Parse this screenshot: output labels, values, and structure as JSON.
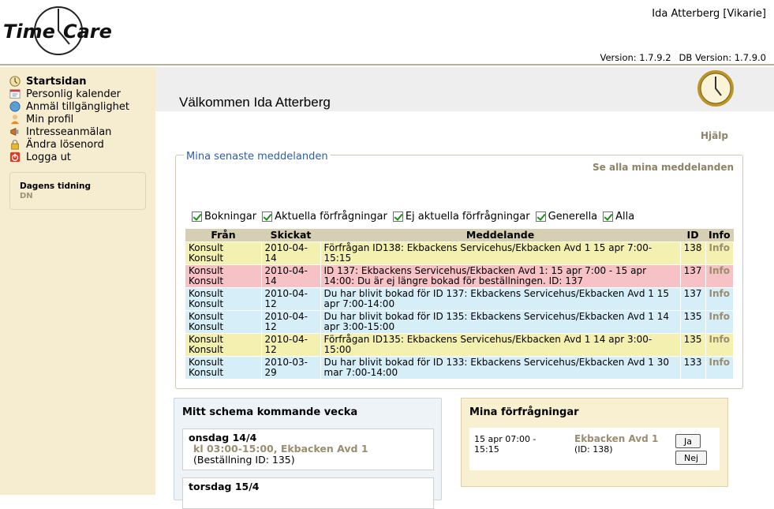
{
  "header": {
    "user": "Ida Atterberg [Vikarie]",
    "version": "Version: 1.7.9.2",
    "db_version": "DB Version: 1.7.9.0",
    "logo_text": "TimeCare"
  },
  "sidebar": {
    "items": [
      {
        "label": "Startsidan",
        "icon": "clock-icon",
        "active": true
      },
      {
        "label": "Personlig kalender",
        "icon": "calendar-icon"
      },
      {
        "label": "Anmäl tillgänglighet",
        "icon": "globe-icon"
      },
      {
        "label": "Min profil",
        "icon": "user-icon"
      },
      {
        "label": "Intresseanmälan",
        "icon": "megaphone-icon"
      },
      {
        "label": "Ändra lösenord",
        "icon": "lock-icon"
      },
      {
        "label": "Logga ut",
        "icon": "logout-icon"
      }
    ],
    "news": {
      "title": "Dagens tidning",
      "value": "DN"
    }
  },
  "main": {
    "welcome": "Välkommen Ida Atterberg",
    "help": "Hjälp"
  },
  "messages": {
    "title": "Mina senaste meddelanden",
    "see_all": "Se alla mina meddelanden",
    "filters": [
      "Bokningar",
      "Aktuella förfrågningar",
      "Ej aktuella förfrågningar",
      "Generella",
      "Alla"
    ],
    "columns": [
      "Från",
      "Skickat",
      "Meddelande",
      "ID",
      "Info"
    ],
    "rows": [
      {
        "from": "Konsult Konsult",
        "sent": "2010-04-14",
        "message": "Förfrågan ID138: Ekbackens Servicehus/Ekbacken Avd 1 15 apr 7:00-15:15",
        "id": "138",
        "info": "Info"
      },
      {
        "from": "Konsult Konsult",
        "sent": "2010-04-14",
        "message": "ID 137: Ekbackens Servicehus/Ekbacken Avd 1: 15 apr 7:00 - 15 apr 14:00: Du är ej längre bokad för beställningen. ID: 137",
        "id": "137",
        "info": "Info"
      },
      {
        "from": "Konsult Konsult",
        "sent": "2010-04-12",
        "message": "Du har blivit bokad för ID 137: Ekbackens Servicehus/Ekbacken Avd 1 15 apr 7:00-14:00",
        "id": "137",
        "info": "Info"
      },
      {
        "from": "Konsult Konsult",
        "sent": "2010-04-12",
        "message": "Du har blivit bokad för ID 135: Ekbackens Servicehus/Ekbacken Avd 1 14 apr 3:00-15:00",
        "id": "135",
        "info": "Info"
      },
      {
        "from": "Konsult Konsult",
        "sent": "2010-04-12",
        "message": "Förfrågan ID135: Ekbackens Servicehus/Ekbacken Avd 1 14 apr 3:00-15:00",
        "id": "135",
        "info": "Info"
      },
      {
        "from": "Konsult Konsult",
        "sent": "2010-03-29",
        "message": "Du har blivit bokad för ID 133: Ekbackens Servicehus/Ekbacken Avd 1 30 mar 7:00-14:00",
        "id": "133",
        "info": "Info"
      }
    ]
  },
  "schedule": {
    "title": "Mitt schema kommande vecka",
    "days": [
      {
        "day": "onsdag 14/4",
        "shift": "kl 03:00-15:00, Ekbacken Avd 1",
        "note": "(Beställning ID: 135)"
      },
      {
        "day": "torsdag 15/4"
      }
    ]
  },
  "requests": {
    "title": "Mina förfrågningar",
    "item": {
      "time": "15 apr 07:00 - 15:15",
      "place": "Ekbacken Avd 1",
      "id": "(ID: 138)"
    },
    "yes": "Ja",
    "no": "Nej"
  },
  "colors": {
    "row_yellow": "#f3f0b0",
    "row_red": "#f7c2c6",
    "row_blue": "#d5eef7",
    "sidebar_bg": "#f6ecd0",
    "link_brown": "#9a8d70",
    "title_blue": "#2e5da8"
  }
}
